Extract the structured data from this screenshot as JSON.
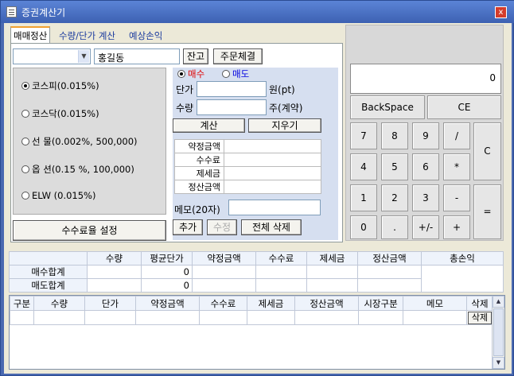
{
  "window": {
    "title": "증권계산기",
    "close_label": "x"
  },
  "tabs": [
    {
      "label": "매매정산",
      "active": true
    },
    {
      "label": "수량/단가 계산",
      "active": false
    },
    {
      "label": "예상손익",
      "active": false
    }
  ],
  "top": {
    "account_value": "",
    "name_value": "홍길동",
    "balance_button": "잔고",
    "order_button": "주문체결"
  },
  "rates": [
    {
      "label": "코스피(0.015%)",
      "checked": true
    },
    {
      "label": "코스닥(0.015%)",
      "checked": false
    },
    {
      "label": "선   물(0.002%,  500,000)",
      "checked": false
    },
    {
      "label": "옵   션(0.15 %,  100,000)",
      "checked": false
    },
    {
      "label": "ELW (0.015%)",
      "checked": false
    }
  ],
  "fee_setting_button": "수수료율 설정",
  "trade": {
    "buy_label": "매수",
    "sell_label": "매도",
    "price_label": "단가",
    "price_unit": "원(pt)",
    "qty_label": "수량",
    "qty_unit": "주(계약)",
    "calc_button": "계산",
    "clear_button": "지우기",
    "results": [
      "약정금액",
      "수수료",
      "제세금",
      "정산금액"
    ],
    "memo_label": "메모(20자)",
    "add_button": "추가",
    "edit_button": "수정",
    "delete_all_button": "전체 삭제"
  },
  "calculator": {
    "display": "0",
    "backspace": "BackSpace",
    "ce": "CE",
    "keys": [
      "7",
      "8",
      "9",
      "/",
      "4",
      "5",
      "6",
      "*",
      "1",
      "2",
      "3",
      "-",
      "0",
      ".",
      "+/-",
      "+"
    ],
    "c": "C",
    "equals": "="
  },
  "summary": {
    "headers": [
      "",
      "수량",
      "평균단가",
      "약정금액",
      "수수료",
      "제세금",
      "정산금액",
      "총손익"
    ],
    "rows": [
      {
        "label": "매수합계",
        "avg": "0"
      },
      {
        "label": "매도합계",
        "avg": "0"
      }
    ]
  },
  "detail": {
    "headers": [
      "구분",
      "수량",
      "단가",
      "약정금액",
      "수수료",
      "제세금",
      "정산금액",
      "시장구분",
      "메모",
      "삭제"
    ],
    "row_delete": "삭제"
  }
}
